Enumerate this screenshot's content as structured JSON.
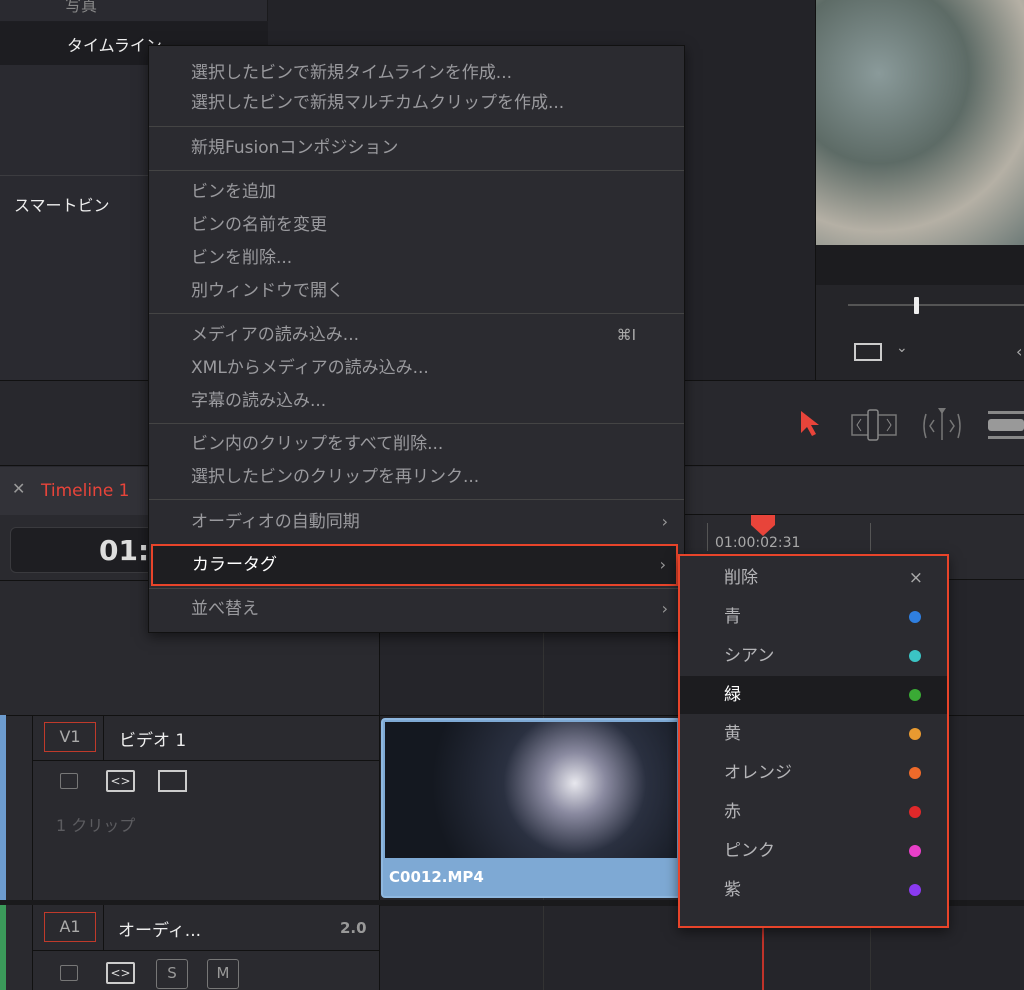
{
  "media_pool": {
    "items": [
      {
        "label": "写真"
      },
      {
        "label": "タイムライン"
      }
    ],
    "smart_bin_label": "スマートビン"
  },
  "timeline": {
    "tab_title": "Timeline 1",
    "timecode": "01:",
    "ruler_timecode": "01:00:02:31"
  },
  "tracks": {
    "video": {
      "badge": "V1",
      "name": "ビデオ 1",
      "clip_count": "1 クリップ",
      "clip_name": "C0012.MP4"
    },
    "audio": {
      "badge": "A1",
      "name": "オーディ...",
      "channel": "2.0",
      "solo": "S",
      "mute": "M"
    }
  },
  "context_menu": {
    "items": [
      {
        "label": "選択したビンで新規タイムラインを作成..."
      },
      {
        "label": "選択したビンで新規マルチカムクリップを作成..."
      },
      {
        "label": "新規Fusionコンポジション"
      },
      {
        "label": "ビンを追加"
      },
      {
        "label": "ビンの名前を変更"
      },
      {
        "label": "ビンを削除..."
      },
      {
        "label": "別ウィンドウで開く"
      },
      {
        "label": "メディアの読み込み...",
        "shortcut": "⌘I"
      },
      {
        "label": "XMLからメディアの読み込み..."
      },
      {
        "label": "字幕の読み込み..."
      },
      {
        "label": "ビン内のクリップをすべて削除..."
      },
      {
        "label": "選択したビンのクリップを再リンク..."
      },
      {
        "label": "オーディオの自動同期"
      },
      {
        "label": "カラータグ"
      },
      {
        "label": "並べ替え"
      }
    ]
  },
  "color_tag_submenu": {
    "items": [
      {
        "label": "削除",
        "icon": "×"
      },
      {
        "label": "青",
        "color": "#2f7fe0"
      },
      {
        "label": "シアン",
        "color": "#3bc4c4"
      },
      {
        "label": "緑",
        "color": "#3aaa35"
      },
      {
        "label": "黄",
        "color": "#e89a30"
      },
      {
        "label": "オレンジ",
        "color": "#ee6a2a"
      },
      {
        "label": "赤",
        "color": "#e0282a"
      },
      {
        "label": "ピンク",
        "color": "#e83fc8"
      },
      {
        "label": "紫",
        "color": "#8a3af0"
      }
    ]
  },
  "accent_color": "#e8443a"
}
